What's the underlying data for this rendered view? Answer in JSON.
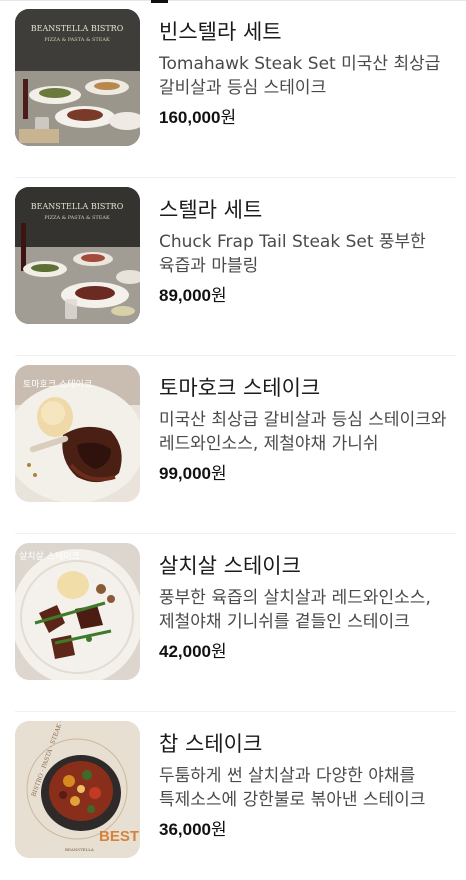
{
  "tab_indicator": {
    "active_index": 1
  },
  "menu_items": [
    {
      "name": "빈스텔라 세트",
      "description": "Tomahawk Steak Set 미국산 최상급 갈비살과 등심 스테이크",
      "price_number": "160,000",
      "price_unit": "원",
      "photo_text": [
        "BEANSTELLA BISTRO",
        "PIZZA & PASTA & STEAK"
      ],
      "photo_icon": "food-photo"
    },
    {
      "name": "스텔라 세트",
      "description": "Chuck Frap Tail Steak Set 풍부한 육즙과 마블링",
      "price_number": "89,000",
      "price_unit": "원",
      "photo_text": [
        "BEANSTELLA BISTRO",
        "PIZZA & PASTA & STEAK"
      ],
      "photo_icon": "food-photo"
    },
    {
      "name": "토마호크 스테이크",
      "description": "미국산 최상급 갈비살과 등심 스테이크와 레드와인소스, 제철야채 가니쉬",
      "price_number": "99,000",
      "price_unit": "원",
      "photo_text": [
        "토마호크 스테이크"
      ],
      "photo_icon": "food-photo"
    },
    {
      "name": "살치살 스테이크",
      "description": "풍부한 육즙의 살치살과 레드와인소스, 제철야채 기니쉬를 곁들인 스테이크",
      "price_number": "42,000",
      "price_unit": "원",
      "photo_text": [
        "살치살 스테이크"
      ],
      "photo_icon": "food-photo"
    },
    {
      "name": "찹 스테이크",
      "description": "두툼하게 썬 살치살과 다양한 야채를 특제소스에 강한불로 볶아낸 스테이크",
      "price_number": "36,000",
      "price_unit": "원",
      "photo_text": [
        "BISTRO · PASTA · STEAK · SALAD",
        "BEST",
        "BEANSTELLA"
      ],
      "photo_icon": "food-photo"
    }
  ]
}
